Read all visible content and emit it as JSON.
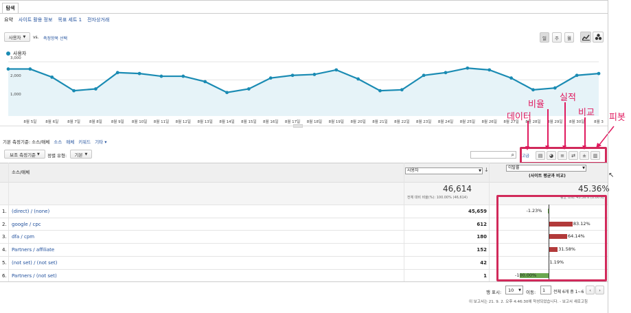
{
  "tab": "탐색",
  "subnav": [
    "요약",
    "사이트 활용 정보",
    "목표 세트 1",
    "전자상거래"
  ],
  "metric_select": "사용자",
  "vs_label": "vs.",
  "metric_compare_link": "측정항목 선택",
  "period_buttons": [
    "일",
    "주",
    "월"
  ],
  "legend_label": "사용자",
  "chart_data": {
    "type": "area",
    "series": [
      {
        "name": "사용자",
        "values": [
          2600,
          2600,
          2150,
          1400,
          1500,
          2400,
          2350,
          2200,
          2200,
          1900,
          1300,
          1500,
          2100,
          2250,
          2300,
          2550,
          2050,
          1400,
          1450,
          2250,
          2400,
          2650,
          2550,
          2100,
          1450,
          1550,
          2250,
          2350
        ]
      }
    ],
    "categories": [
      "8월 5일",
      "8월 6일",
      "8월 7일",
      "8월 8일",
      "8월 9일",
      "8월 10일",
      "8월 11일",
      "8월 12일",
      "8월 13일",
      "8월 14일",
      "8월 15일",
      "8월 16일",
      "8월 17일",
      "8월 18일",
      "8월 19일",
      "8월 20일",
      "8월 21일",
      "8월 22일",
      "8월 23일",
      "8월 24일",
      "8월 25일",
      "8월 26일",
      "8월 27일",
      "8월 28일",
      "8월 29일",
      "8월 30일",
      "8월 3"
    ],
    "y_ticks": [
      "3,000",
      "2,000",
      "1,000"
    ],
    "ylim": [
      0,
      3000
    ],
    "grid": true,
    "color": "#1a8bb3"
  },
  "dimension_bar": {
    "label": "기본 측정기준:",
    "active": "소스/매체",
    "options": [
      "소스",
      "매체",
      "키워드",
      "기타"
    ]
  },
  "secondary_dim": "보조 측정기준",
  "sort_label": "정렬 유형:",
  "sort_value": "기본",
  "advanced_label": "고급",
  "annotations": {
    "data": "데이터",
    "ratio": "비율",
    "performance": "실적",
    "compare": "비교",
    "pivot": "피봇"
  },
  "table": {
    "col_source": "소스/매체",
    "col_metric_select": "사용자",
    "col_compare_select": "이탈률",
    "col_compare_sub": "(사이트 평균과 비교)",
    "total_value": "46,614",
    "total_sub": "전체 대비 비율(%): 100.00% (46,614)",
    "compare_total": "45.36%",
    "compare_total_sub": "평균 조회: 45.36% (0.00%)",
    "rows": [
      {
        "num": "1.",
        "source": "(direct) / (none)",
        "users": "45,659",
        "pct": "-1.23%",
        "val": -1.23
      },
      {
        "num": "2.",
        "source": "google / cpc",
        "users": "612",
        "pct": "83.12%",
        "val": 83.12
      },
      {
        "num": "3.",
        "source": "dfa / cpm",
        "users": "180",
        "pct": "64.14%",
        "val": 64.14
      },
      {
        "num": "4.",
        "source": "Partners / affiliate",
        "users": "152",
        "pct": "31.58%",
        "val": 31.58
      },
      {
        "num": "5.",
        "source": "(not set) / (not set)",
        "users": "42",
        "pct": "1.19%",
        "val": 1.19
      },
      {
        "num": "6.",
        "source": "Partners / (not set)",
        "users": "1",
        "pct": "-100.00%",
        "val": -100
      }
    ]
  },
  "pager": {
    "show_label": "행 표시:",
    "show_value": "10",
    "goto_label": "이동:",
    "goto_value": "1",
    "range": "전체 6개 중 1~6"
  },
  "footer": "이 보고서는 21. 9. 2. 오후 4:46:30에 작성되었습니다. - 보고서 새로고침"
}
